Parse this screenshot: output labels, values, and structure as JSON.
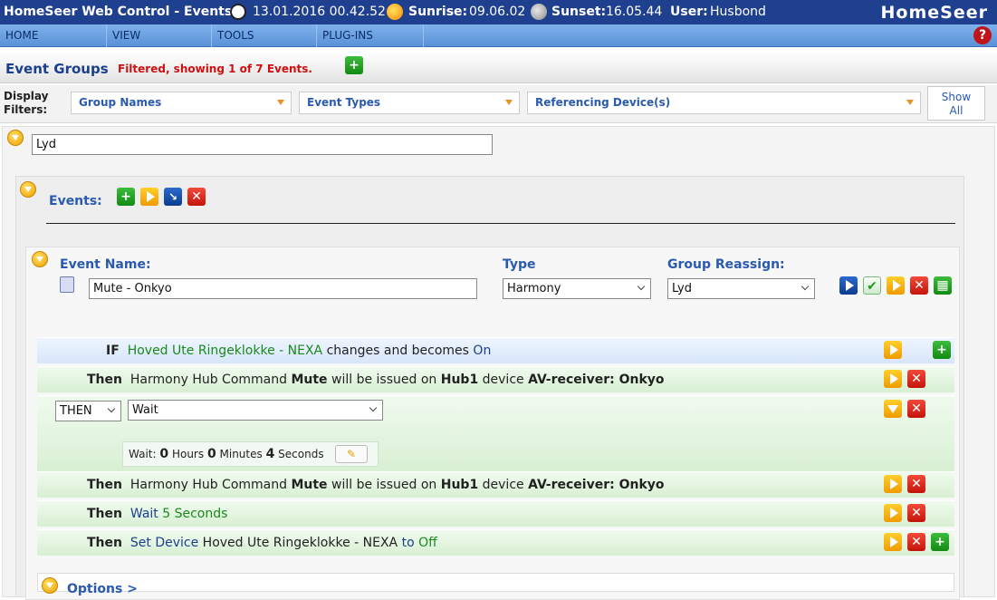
{
  "titlebar": {
    "app_title": "HomeSeer Web Control - Events",
    "datetime": "13.01.2016 00.42.52",
    "sunrise_label": "Sunrise:",
    "sunrise_value": "09.06.02",
    "sunset_label": "Sunset:",
    "sunset_value": "16.05.44",
    "user_label": "User:",
    "user_value": "Husbond",
    "logo": "HomeSeer"
  },
  "menu": [
    "HOME",
    "VIEW",
    "TOOLS",
    "PLUG-INS"
  ],
  "header": {
    "title": "Event Groups",
    "filter_status": "Filtered, showing 1 of 7 Events."
  },
  "filters": {
    "label_line1": "Display",
    "label_line2": "Filters:",
    "group_names": "Group Names",
    "event_types": "Event Types",
    "referencing_devices": "Referencing Device(s)",
    "show_all_line1": "Show",
    "show_all_line2": "All"
  },
  "group": {
    "name": "Lyd"
  },
  "events_section": {
    "label": "Events:"
  },
  "event": {
    "name_label": "Event Name:",
    "name_value": "Mute - Onkyo",
    "type_label": "Type",
    "type_value": "Harmony",
    "group_label": "Group Reassign:",
    "group_value": "Lyd"
  },
  "rows": {
    "if_kw": "IF",
    "if_device": "Hoved Ute Ringeklokke - NEXA",
    "if_mid": "changes and becomes",
    "if_state": "On",
    "then_kw": "Then",
    "then1_a": "Harmony Hub Command",
    "then1_cmd": "Mute",
    "then1_b": "will be issued on",
    "then1_hub": "Hub1",
    "then1_c": "device",
    "then1_dev": "AV-receiver: Onkyo",
    "then_select": "THEN",
    "action_select": "Wait",
    "wait_label": "Wait:",
    "wait_hours": "0",
    "hours_label": "Hours",
    "wait_minutes": "0",
    "minutes_label": "Minutes",
    "wait_seconds": "4",
    "seconds_label": "Seconds",
    "then3_wait": "Wait",
    "then3_secs": "5 Seconds",
    "then4_action": "Set Device",
    "then4_device": "Hoved Ute Ringeklokke - NEXA",
    "then4_to": "to",
    "then4_state": "Off"
  },
  "options": {
    "label": "Options >"
  }
}
